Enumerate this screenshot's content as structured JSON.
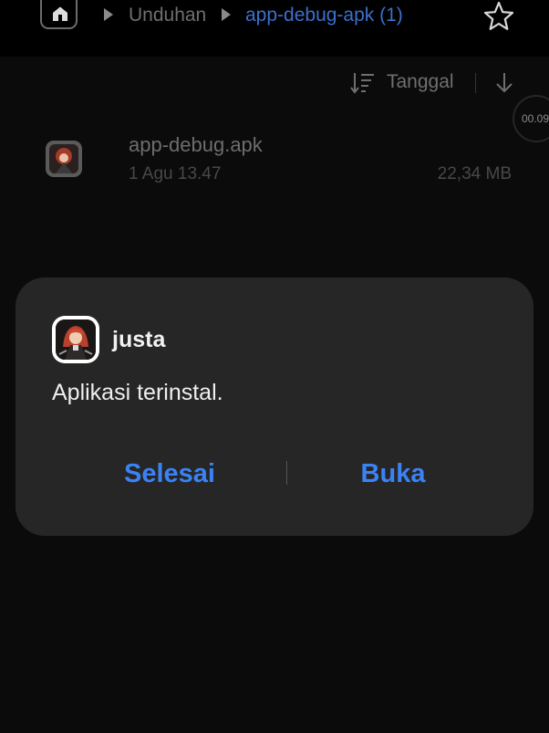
{
  "breadcrumb": {
    "items": [
      {
        "label": "Unduhan",
        "color": "#6f6f6f"
      },
      {
        "label": "app-debug-apk (1)",
        "color": "#3c6fcc"
      }
    ]
  },
  "sort": {
    "label": "Tanggal"
  },
  "timer": {
    "label": "00.09"
  },
  "file": {
    "name": "app-debug.apk",
    "date": "1 Agu 13.47",
    "size": "22,34 MB"
  },
  "dialog": {
    "app_name": "justa",
    "message": "Aplikasi terinstal.",
    "done_label": "Selesai",
    "open_label": "Buka",
    "accent": "#3b82f6"
  }
}
